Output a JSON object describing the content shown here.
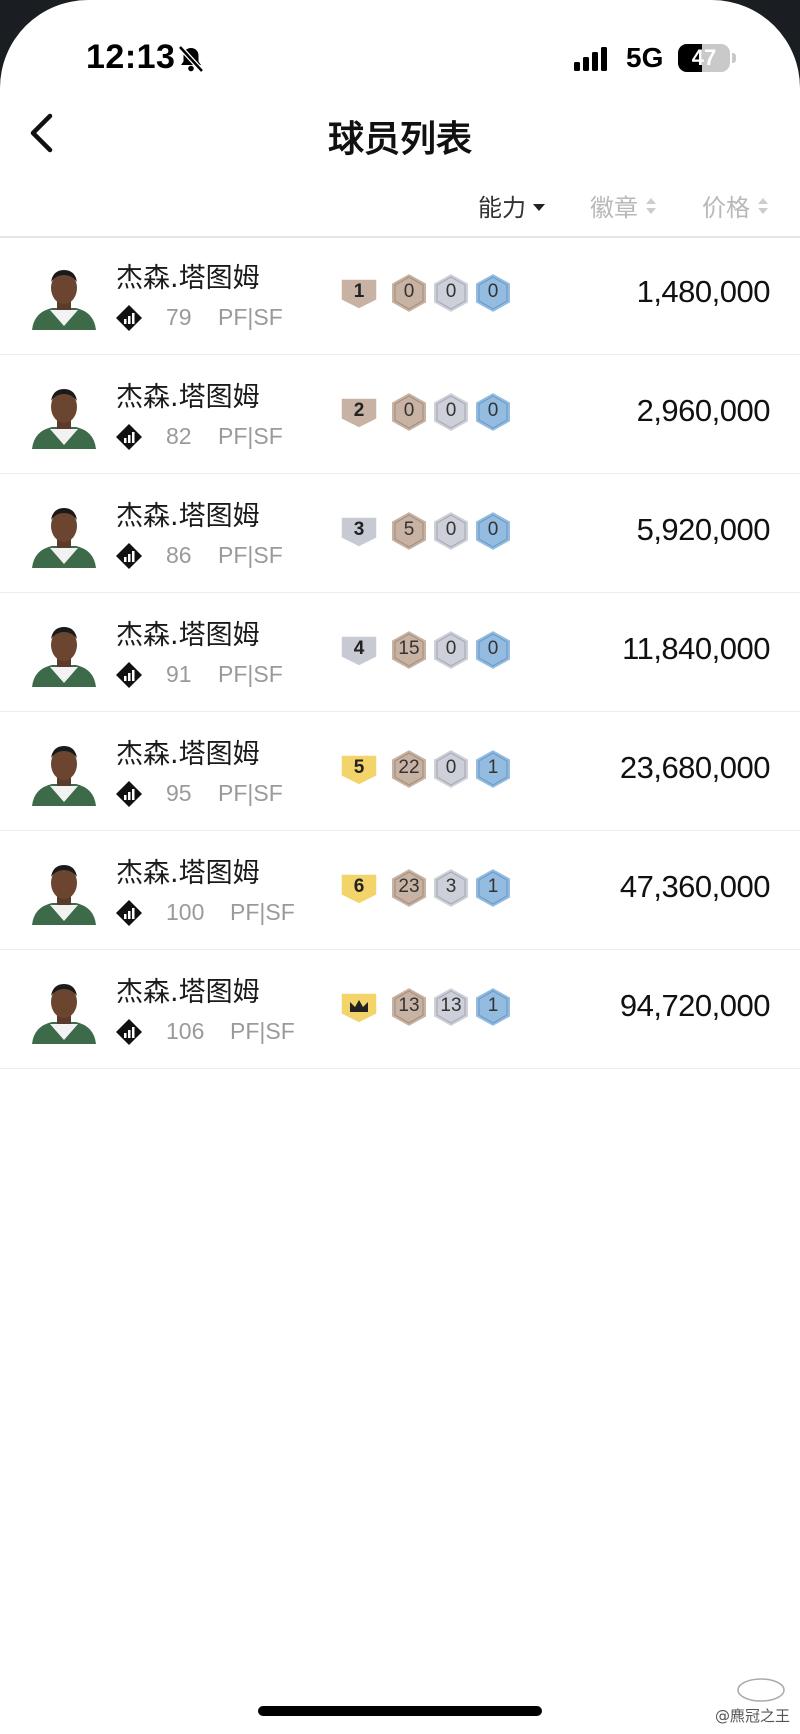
{
  "status_bar": {
    "time": "12:13",
    "network": "5G",
    "battery": "47",
    "battery_level": 0.47
  },
  "header": {
    "title": "球员列表",
    "back_icon": "chevron-left-icon"
  },
  "sort_bar": [
    {
      "label": "能力",
      "active": true,
      "direction": "desc"
    },
    {
      "label": "徽章",
      "active": false
    },
    {
      "label": "价格",
      "active": false
    }
  ],
  "colors": {
    "gold": "#f2d46b",
    "bronze": "#c7b2a3",
    "silver": "#c7cad3",
    "blue": "#8cb3d9"
  },
  "players": [
    {
      "name": "杰森.塔图姆",
      "rating": "79",
      "position": "PF|SF",
      "level": "1",
      "badges": [
        "0",
        "0",
        "0"
      ],
      "price": "1,480,000",
      "tier": "bronze"
    },
    {
      "name": "杰森.塔图姆",
      "rating": "82",
      "position": "PF|SF",
      "level": "2",
      "badges": [
        "0",
        "0",
        "0"
      ],
      "price": "2,960,000",
      "tier": "bronze"
    },
    {
      "name": "杰森.塔图姆",
      "rating": "86",
      "position": "PF|SF",
      "level": "3",
      "badges": [
        "5",
        "0",
        "0"
      ],
      "price": "5,920,000",
      "tier": "silver"
    },
    {
      "name": "杰森.塔图姆",
      "rating": "91",
      "position": "PF|SF",
      "level": "4",
      "badges": [
        "15",
        "0",
        "0"
      ],
      "price": "11,840,000",
      "tier": "silver"
    },
    {
      "name": "杰森.塔图姆",
      "rating": "95",
      "position": "PF|SF",
      "level": "5",
      "badges": [
        "22",
        "0",
        "1"
      ],
      "price": "23,680,000",
      "tier": "gold"
    },
    {
      "name": "杰森.塔图姆",
      "rating": "100",
      "position": "PF|SF",
      "level": "6",
      "badges": [
        "23",
        "3",
        "1"
      ],
      "price": "47,360,000",
      "tier": "gold"
    },
    {
      "name": "杰森.塔图姆",
      "rating": "106",
      "position": "PF|SF",
      "level": "",
      "badges": [
        "13",
        "13",
        "1"
      ],
      "price": "94,720,000",
      "tier": "gold",
      "crown": true
    }
  ],
  "watermark": "@麃冠之王"
}
